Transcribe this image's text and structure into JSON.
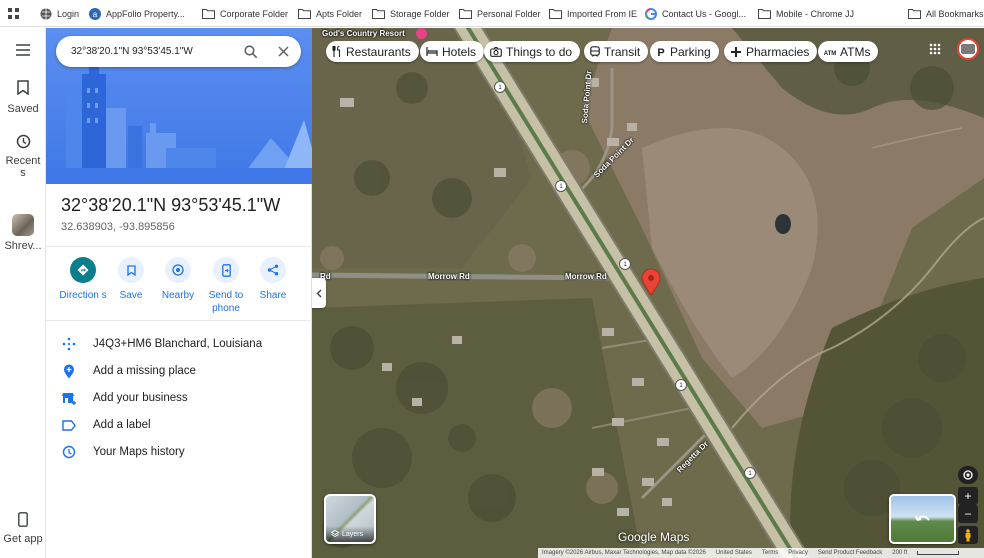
{
  "bookmarks": {
    "items": [
      {
        "label": "Login",
        "icon": "globe-icon"
      },
      {
        "label": "AppFolio Property...",
        "icon": "appfolio-icon"
      },
      {
        "label": "Corporate Folder",
        "icon": "folder-icon"
      },
      {
        "label": "Apts Folder",
        "icon": "folder-icon"
      },
      {
        "label": "Storage Folder",
        "icon": "folder-icon"
      },
      {
        "label": "Personal Folder",
        "icon": "folder-icon"
      },
      {
        "label": "Imported From IE",
        "icon": "folder-icon"
      },
      {
        "label": "Contact Us - Googl...",
        "icon": "google-icon"
      },
      {
        "label": "Mobile - Chrome JJ",
        "icon": "folder-icon"
      },
      {
        "label": "All Bookmarks",
        "icon": "folder-icon"
      }
    ]
  },
  "rail": {
    "saved": "Saved",
    "recents": "Recent s",
    "recent_place": "Shrev...",
    "get_app": "Get app"
  },
  "search": {
    "value": "32°38'20.1\"N 93°53'45.1\"W"
  },
  "place": {
    "title": "32°38'20.1\"N 93°53'45.1\"W",
    "coords": "32.638903, -93.895856"
  },
  "actions": {
    "directions": "Direction s",
    "save": "Save",
    "nearby": "Nearby",
    "send": "Send to phone",
    "share": "Share"
  },
  "info": {
    "plus_code": "J4Q3+HM6 Blanchard, Louisiana",
    "missing_place": "Add a missing place",
    "business": "Add your business",
    "label": "Add a label",
    "history": "Your Maps history"
  },
  "chips": [
    "Restaurants",
    "Hotels",
    "Things to do",
    "Transit",
    "Parking",
    "Pharmacies",
    "ATMs"
  ],
  "map": {
    "poi": "God's Country Resort",
    "roads": {
      "morrow_left": "Rd",
      "morrow1": "Morrow Rd",
      "morrow2": "Morrow Rd",
      "soda_point": "Soda Point Dr",
      "soda_point2": "Soda Point Dr",
      "regetta": "Regetta Dr"
    },
    "route_shield": "1",
    "layers": "Layers",
    "google_logo": "Google Maps",
    "footer": {
      "imagery": "Imagery ©2026 Airbus, Maxar Technologies, Map data ©2026",
      "country": "United States",
      "terms": "Terms",
      "privacy": "Privacy",
      "feedback": "Send Product Feedback",
      "scale": "200 ft"
    }
  },
  "colors": {
    "accent": "#1a73e8",
    "pin": "#ea4335",
    "hero": "#4a84ec"
  }
}
